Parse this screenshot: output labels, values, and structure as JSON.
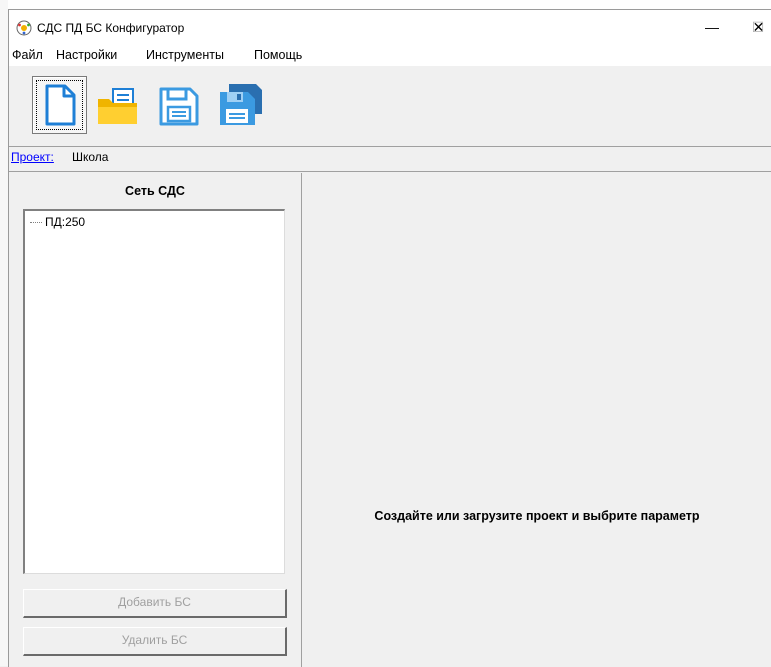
{
  "window": {
    "title": "СДС ПД БС Конфигуратор",
    "controls": {
      "minimize": "—",
      "maximize": "☐",
      "close": "✕"
    }
  },
  "menu": [
    {
      "label": "Файл"
    },
    {
      "label": "Настройки"
    },
    {
      "label": "Инструменты"
    },
    {
      "label": "Помощь"
    }
  ],
  "toolbar": [
    {
      "icon": "new-document-icon",
      "state": "focused"
    },
    {
      "icon": "open-folder-icon"
    },
    {
      "icon": "save-icon"
    },
    {
      "icon": "save-as-icon"
    }
  ],
  "project": {
    "label": "Проект:",
    "name": "Школа"
  },
  "network_panel": {
    "title": "Сеть СДС",
    "tree": [
      {
        "label": "ПД:250"
      }
    ],
    "add_button": {
      "label": "Добавить БС",
      "enabled": false
    },
    "remove_button": {
      "label": "Удалить БС",
      "enabled": false
    }
  },
  "main": {
    "placeholder": "Создайте или загрузите проект и выбрите параметр"
  },
  "colors": {
    "link": "#0000ff",
    "folder": "#f5c000",
    "floppy": "#3b9ae1",
    "disabled_text": "#a0a0a0"
  }
}
